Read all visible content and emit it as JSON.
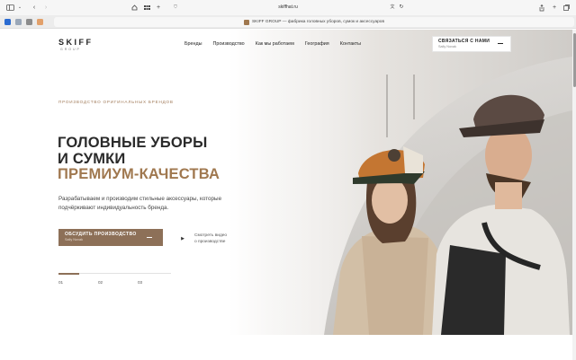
{
  "browser": {
    "url": "skiffhat.ru",
    "tab_title": "SKIFF GROUP — фабрика головных уборов, сумок и аксессуаров"
  },
  "header": {
    "logo_main": "SKIFF",
    "logo_sub": "GROUP",
    "nav": [
      "Бренды",
      "Производство",
      "Как мы работаем",
      "География",
      "Контакты"
    ],
    "cta_title": "СВЯЗАТЬСЯ С НАМИ",
    "cta_sub": "Sally Novak"
  },
  "hero": {
    "eyebrow": "ПРОИЗВОДСТВО ОРИГИНАЛЬНЫХ БРЕНДОВ",
    "title_line1": "ГОЛОВНЫЕ УБОРЫ",
    "title_line2": "И СУМКИ",
    "title_accent": "ПРЕМИУМ-КАЧЕСТВА",
    "lead": "Разрабатываем и производим стильные аксессуары, которые подчёркивают индивидуальность бренда.",
    "button_title": "ОБСУДИТЬ ПРОИЗВОДСТВО",
    "button_sub": "Sally Novak",
    "video_line1": "Смотреть видео",
    "video_line2": "о производстве",
    "slides": [
      "01",
      "02",
      "03"
    ],
    "progress": 0.18
  },
  "colors": {
    "accent": "#8d7058",
    "accent_text": "#a0784f"
  }
}
